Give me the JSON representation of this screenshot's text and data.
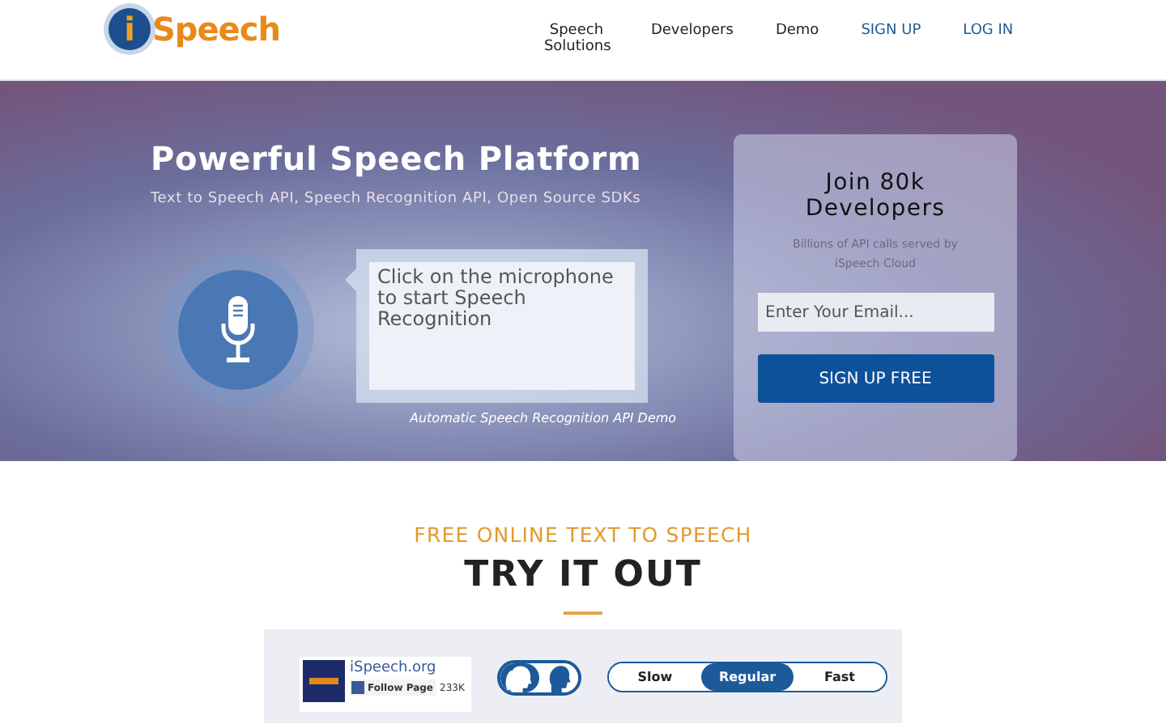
{
  "header": {
    "logo_mark": "i",
    "logo_text": "Speech",
    "nav": [
      {
        "label": "Speech Solutions",
        "kind": "plain"
      },
      {
        "label": "Developers",
        "kind": "plain"
      },
      {
        "label": "Demo",
        "kind": "plain"
      },
      {
        "label": "SIGN UP",
        "kind": "accent"
      },
      {
        "label": "LOG IN",
        "kind": "accent"
      }
    ]
  },
  "hero": {
    "title": "Powerful Speech Platform",
    "subtitle": "Text to Speech API, Speech Recognition API, Open Source SDKs",
    "bubble": "Click on the microphone to start Speech Recognition",
    "caption": "Automatic Speech Recognition API Demo",
    "signup": {
      "title": "Join 80k Developers",
      "note": "Billions of API calls served by iSpeech Cloud",
      "email": {
        "placeholder": "Enter Your Email..."
      },
      "button": "SIGN UP FREE"
    }
  },
  "demo": {
    "kicker": "FREE ONLINE TEXT TO SPEECH",
    "title": "TRY IT OUT",
    "social": {
      "name": "iSpeech.org",
      "follow": "Follow Page",
      "count": "233K"
    },
    "voices": [
      {
        "kind": "female",
        "selected": true
      },
      {
        "kind": "male",
        "selected": false
      }
    ],
    "speeds": [
      {
        "label": "Slow",
        "selected": false
      },
      {
        "label": "Regular",
        "selected": true
      },
      {
        "label": "Fast",
        "selected": false
      }
    ]
  }
}
